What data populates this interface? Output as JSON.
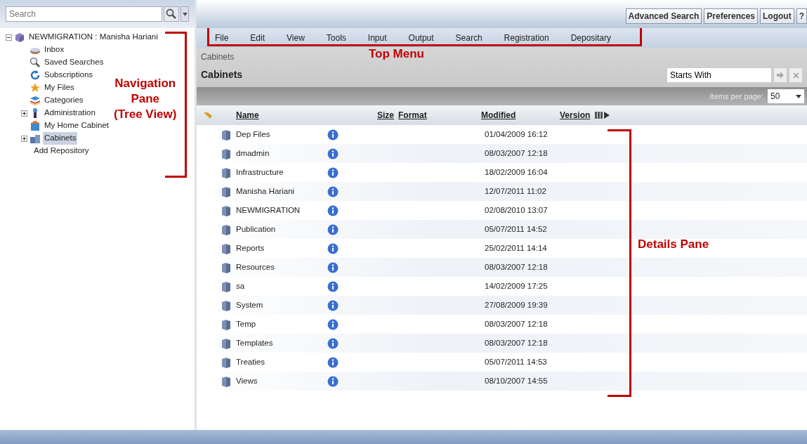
{
  "search": {
    "placeholder": "Search"
  },
  "tree": [
    {
      "label": "NEWMIGRATION : Manisha Hariani",
      "kind": "repository",
      "expanded": true,
      "selected": false,
      "children": [
        {
          "label": "Inbox",
          "kind": "inbox",
          "selected": false
        },
        {
          "label": "Saved Searches",
          "kind": "search",
          "selected": false
        },
        {
          "label": "Subscriptions",
          "kind": "subscriptions",
          "selected": false
        },
        {
          "label": "My Files",
          "kind": "star",
          "selected": false
        },
        {
          "label": "Categories",
          "kind": "categories",
          "selected": false
        },
        {
          "label": "Administration",
          "kind": "admin",
          "expanded": false,
          "selected": false
        },
        {
          "label": "My Home Cabinet",
          "kind": "home",
          "selected": false
        },
        {
          "label": "Cabinets",
          "kind": "cabinets",
          "expanded": false,
          "selected": true
        }
      ]
    },
    {
      "label": "Add Repository",
      "kind": "link",
      "selected": false
    }
  ],
  "top_buttons": [
    "Advanced Search",
    "Preferences",
    "Logout",
    "?"
  ],
  "menu": [
    "File",
    "Edit",
    "View",
    "Tools",
    "Input",
    "Output",
    "Search",
    "Registration",
    "Depositary"
  ],
  "breadcrumb": "Cabinets",
  "heading": "Cabinets",
  "filter": {
    "value": "Starts With"
  },
  "items_per_page": {
    "label": "Items per page:",
    "value": "50"
  },
  "table": {
    "columns": [
      "Name",
      "Size",
      "Format",
      "Modified",
      "Version"
    ],
    "rows": [
      {
        "name": "Dep Files",
        "modified": "01/04/2009 16:12"
      },
      {
        "name": "dmadmin",
        "modified": "08/03/2007 12:18"
      },
      {
        "name": "Infrastructure",
        "modified": "18/02/2009 16:04"
      },
      {
        "name": "Manisha Hariani",
        "modified": "12/07/2011 11:02"
      },
      {
        "name": "NEWMIGRATION",
        "modified": "02/08/2010 13:07"
      },
      {
        "name": "Publication",
        "modified": "05/07/2011 14:52"
      },
      {
        "name": "Reports",
        "modified": "25/02/2011 14:14"
      },
      {
        "name": "Resources",
        "modified": "08/03/2007 12:18"
      },
      {
        "name": "sa",
        "modified": "14/02/2009 17:25"
      },
      {
        "name": "System",
        "modified": "27/08/2009 19:39"
      },
      {
        "name": "Temp",
        "modified": "08/03/2007 12:18"
      },
      {
        "name": "Templates",
        "modified": "08/03/2007 12:18"
      },
      {
        "name": "Treaties",
        "modified": "05/07/2011 14:53"
      },
      {
        "name": "Views",
        "modified": "08/10/2007 14:55"
      }
    ]
  },
  "annotations": [
    {
      "kind": "nav",
      "lines": [
        "Navigation",
        "Pane",
        "(Tree View)"
      ]
    },
    {
      "kind": "menu",
      "lines": [
        "Top Menu"
      ]
    },
    {
      "kind": "details",
      "lines": [
        "Details Pane"
      ]
    }
  ]
}
